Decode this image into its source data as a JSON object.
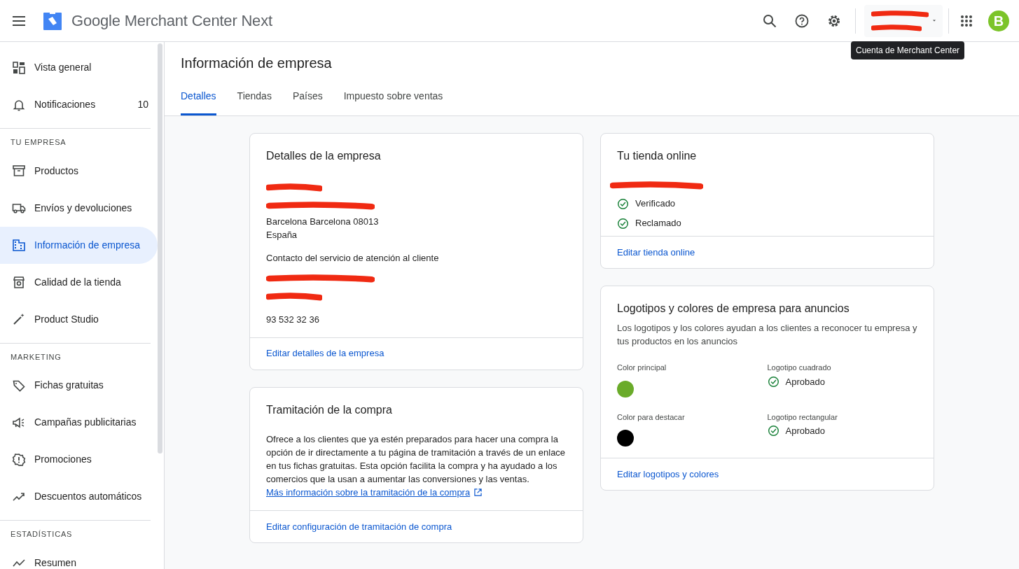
{
  "header": {
    "product_name": "Google Merchant Center Next",
    "tooltip": "Cuenta de Merchant Center",
    "avatar_letter": "B"
  },
  "sidebar": {
    "sections": [
      {
        "items": [
          {
            "label": "Vista general",
            "selected": false
          },
          {
            "label": "Notificaciones",
            "badge": "10",
            "selected": false
          }
        ]
      },
      {
        "heading": "TU EMPRESA",
        "items": [
          {
            "label": "Productos",
            "selected": false
          },
          {
            "label": "Envíos y devoluciones",
            "selected": false
          },
          {
            "label": "Información de empresa",
            "selected": true
          },
          {
            "label": "Calidad de la tienda",
            "selected": false
          },
          {
            "label": "Product Studio",
            "selected": false
          }
        ]
      },
      {
        "heading": "MARKETING",
        "items": [
          {
            "label": "Fichas gratuitas",
            "selected": false
          },
          {
            "label": "Campañas publicitarias",
            "selected": false
          },
          {
            "label": "Promociones",
            "selected": false
          },
          {
            "label": "Descuentos automáticos",
            "selected": false
          }
        ]
      },
      {
        "heading": "ESTADÍSTICAS",
        "items": [
          {
            "label": "Resumen",
            "selected": false
          }
        ]
      }
    ]
  },
  "page": {
    "title": "Información de empresa",
    "tabs": [
      {
        "label": "Detalles",
        "selected": true
      },
      {
        "label": "Tiendas",
        "selected": false
      },
      {
        "label": "Países",
        "selected": false
      },
      {
        "label": "Impuesto sobre ventas",
        "selected": false
      }
    ]
  },
  "business_details": {
    "title": "Detalles de la empresa",
    "lines": [
      {
        "kind": "redacted"
      },
      {
        "kind": "redacted"
      },
      {
        "kind": "text",
        "text": "Barcelona Barcelona 08013"
      },
      {
        "kind": "text",
        "text": "España"
      },
      {
        "kind": "heading",
        "text": "Contacto del servicio de atención al cliente"
      },
      {
        "kind": "redacted"
      },
      {
        "kind": "redacted"
      },
      {
        "kind": "text",
        "text": "93 532 32 36"
      }
    ],
    "action": "Editar detalles de la empresa"
  },
  "checkout": {
    "title": "Tramitación de la compra",
    "description": "Ofrece a los clientes que ya estén preparados para hacer una compra la opción de ir directamente a tu página de tramitación a través de un enlace en tus fichas gratuitas. Esta opción facilita la compra y ha ayudado a los comercios que la usan a aumentar las conversiones y las ventas.",
    "link": "Más información sobre la tramitación de la compra",
    "action": "Editar configuración de tramitación de compra"
  },
  "online_store": {
    "title": "Tu tienda online",
    "statuses": [
      {
        "label": "Verificado"
      },
      {
        "label": "Reclamado"
      }
    ],
    "action": "Editar tienda online"
  },
  "brand": {
    "title": "Logotipos y colores de empresa para anuncios",
    "description": "Los logotipos y los colores ayudan a los clientes a reconocer tu empresa y tus productos en los anuncios",
    "colors": [
      {
        "label": "Color principal",
        "color": "#6aab2a"
      },
      {
        "label": "Color para destacar",
        "color": "#000000"
      }
    ],
    "logos": [
      {
        "label": "Logotipo cuadrado",
        "status": "Aprobado"
      },
      {
        "label": "Logotipo rectangular",
        "status": "Aprobado"
      }
    ],
    "action": "Editar logotipos y colores"
  }
}
